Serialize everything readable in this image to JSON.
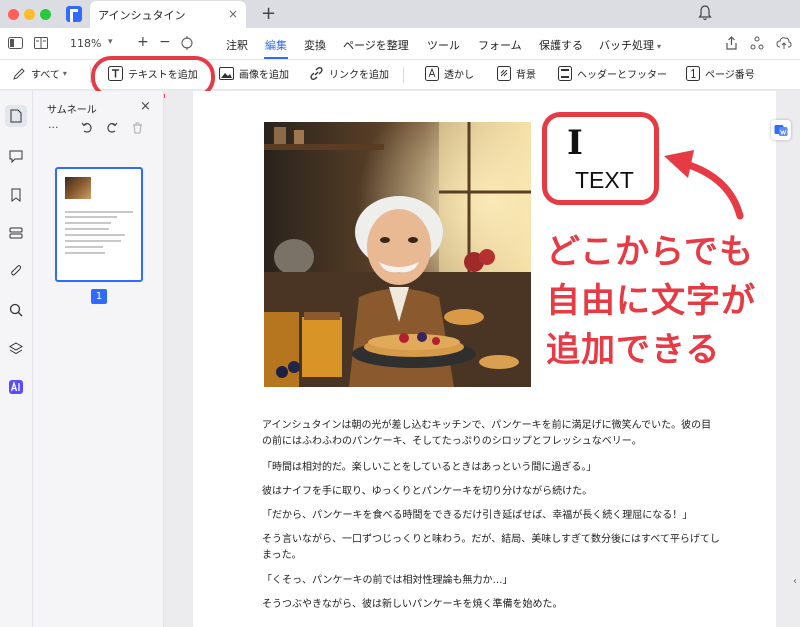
{
  "window": {
    "tab_title": "アインシュタイン",
    "tab_close": "×",
    "new_tab": "+"
  },
  "menubar": {
    "zoom": "118%",
    "zoom_plus": "+",
    "zoom_minus": "−",
    "items": [
      "注釈",
      "編集",
      "変換",
      "ページを整理",
      "ツール",
      "フォーム",
      "保護する",
      "バッチ処理"
    ],
    "active": "編集"
  },
  "toolbar": {
    "all": "すべて",
    "add_text": "テキストを追加",
    "add_image": "画像を追加",
    "add_link": "リンクを追加",
    "watermark": "透かし",
    "background": "背景",
    "header_footer": "ヘッダーとフッター",
    "page_number": "ページ番号"
  },
  "thumbnail_panel": {
    "title": "サムネール",
    "close": "×",
    "more": "···",
    "page_number": "1"
  },
  "document": {
    "paragraphs": [
      "アインシュタインは朝の光が差し込むキッチンで、パンケーキを前に満足げに微笑んでいた。彼の目",
      "の前にはふわふわのパンケーキ、そしてたっぷりのシロップとフレッシュなベリー。",
      "「時間は相対的だ。楽しいことをしているときはあっという間に過ぎる。」",
      "彼はナイフを手に取り、ゆっくりとパンケーキを切り分けながら続けた。",
      "「だから、パンケーキを食べる時間をできるだけ引き延ばせば、幸福が長く続く理屈になる！」",
      "そう言いながら、一口ずつじっくりと味わう。だが、結局、美味しすぎて数分後にはすべて平らげてし",
      "まった。",
      "「くそっ、パンケーキの前では相対性理論も無力か…」",
      "そうつぶやきながら、彼は新しいパンケーキを焼く準備を始めた。"
    ]
  },
  "annotation": {
    "cursor_glyph": "I",
    "text_word": "TEXT",
    "callout_lines": [
      "どこからでも",
      "自由に文字が",
      "追加できる"
    ]
  },
  "colors": {
    "accent": "#2f6bff",
    "highlight": "#e63a44"
  }
}
